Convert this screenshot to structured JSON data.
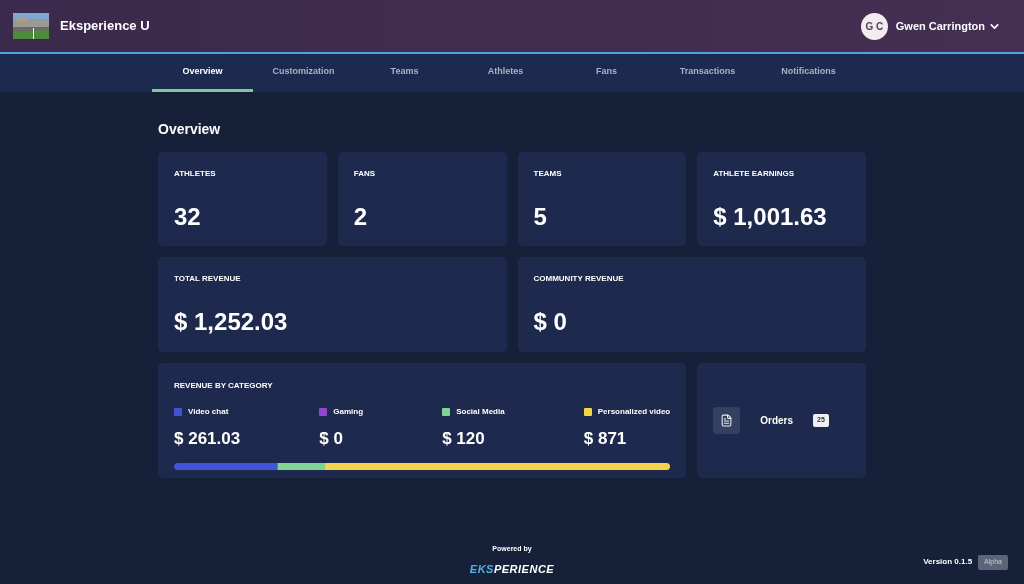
{
  "header": {
    "brand": "Eksperience U",
    "user": {
      "initials": "G C",
      "name": "Gwen Carrington"
    }
  },
  "tabs": [
    {
      "label": "Overview",
      "selected": true
    },
    {
      "label": "Customization",
      "selected": false
    },
    {
      "label": "Teams",
      "selected": false
    },
    {
      "label": "Athletes",
      "selected": false
    },
    {
      "label": "Fans",
      "selected": false
    },
    {
      "label": "Transactions",
      "selected": false
    },
    {
      "label": "Notifications",
      "selected": false
    }
  ],
  "page_title": "Overview",
  "stats": [
    {
      "label": "ATHLETES",
      "value": "32",
      "kind": "small"
    },
    {
      "label": "FANS",
      "value": "2",
      "kind": "small"
    },
    {
      "label": "TEAMS",
      "value": "5",
      "kind": "small"
    },
    {
      "label": "ATHLETE EARNINGS",
      "value": "$ 1,001.63",
      "kind": "small"
    },
    {
      "label": "TOTAL REVENUE",
      "value": "$ 1,252.03",
      "kind": "wide"
    },
    {
      "label": "COMMUNITY REVENUE",
      "value": "$ 0",
      "kind": "wide"
    }
  ],
  "revenue_by_category": {
    "title": "REVENUE BY CATEGORY",
    "categories": [
      {
        "name": "Video chat",
        "value": "$ 261.03",
        "color": "#4353d6"
      },
      {
        "name": "Gaming",
        "value": "$ 0",
        "color": "#9146d0"
      },
      {
        "name": "Social Media",
        "value": "$ 120",
        "color": "#7fd493"
      },
      {
        "name": "Personalized video",
        "value": "$ 871",
        "color": "#f5d44b"
      }
    ]
  },
  "orders": {
    "label": "Orders",
    "count": "25"
  },
  "footer": {
    "powered_by": "Powered by",
    "logo_accent": "EKS",
    "logo_rest": "PERIENCE",
    "version": "Version 0.1.5",
    "badge": "Alpha"
  }
}
